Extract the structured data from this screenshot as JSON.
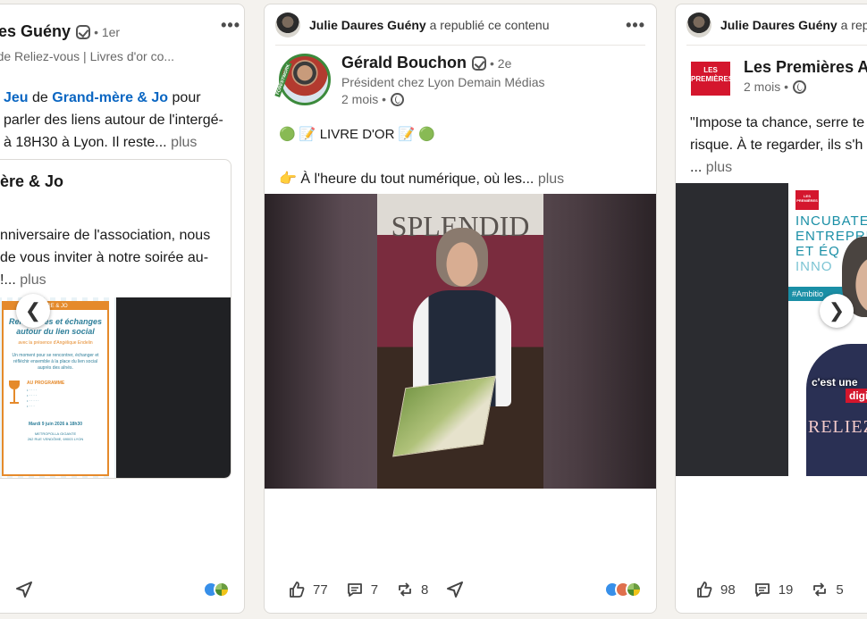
{
  "card1": {
    "actor_name": "ères Guény",
    "degree": "• 1er",
    "actor_sub": "te de Reliez-vous | Livres d'or co...",
    "commentary_link1": "Jeu",
    "commentary_text1": " de ",
    "commentary_link2": "Grand-mère & Jo",
    "commentary_text2": " pour",
    "commentary_line2": "parler des liens autour de l'intergé-",
    "commentary_line3": "à 18H30 à Lyon. Il reste...",
    "more": "plus",
    "inner_title": "ère & Jo",
    "inner_line1": "nniversaire de l'association, nous",
    "inner_line2": "de vous inviter à notre soirée au-",
    "inner_line3": "!...",
    "inner_more": "plus",
    "flyer": {
      "header": "ÈRE & JO",
      "title": "Rencontres et échanges autour du lien social",
      "subtitle": "avec la présence d'Angélique Endelin",
      "body": "Un moment pour se rencontrer, échanger et réfléchir ensemble à la place du lien social auprès des aînés.",
      "programme": "AU PROGRAMME",
      "date": "Mardi 9 juin 2026 à 18h30",
      "venue": "METROPOLLA GIGANTE",
      "address": "262 RUE VENDÔME, 69003 LYON"
    },
    "prev_arrow": "❮"
  },
  "card2": {
    "repost_actor": "Julie Daures Guény",
    "repost_text": " a republié ce contenu",
    "more_dots": "•••",
    "actor_name": "Gérald Bouchon",
    "degree": "• 2e",
    "actor_sub": "Président chez Lyon Demain Médias",
    "actor_meta": "2 mois •",
    "avatar_ring": "FORESTWORK",
    "line1": "🟢 📝 LIVRE D'OR 📝 🟢",
    "line2": "👉 À l'heure du tout numérique, où les...",
    "more": "plus",
    "video_sign": "SPLENDID",
    "likes": "77",
    "comments": "7",
    "reposts": "8"
  },
  "card3": {
    "repost_actor": "Julie Daures Guény",
    "repost_text": " a rep",
    "actor_name": "Les Premières A",
    "actor_meta": "2 mois •",
    "logo_text": "LES PREMIÈRES",
    "line1": "\"Impose ta chance, serre te",
    "line2": "risque. À te regarder, ils s'h",
    "line3": "...",
    "more": "plus",
    "slide": {
      "logo": "LES PREMIÈRES",
      "heading1": "INCUBATE",
      "heading2": "ENTREPRE",
      "heading3": "ET ÉQ",
      "heading4": "INNO",
      "hashtag": "#Ambitio",
      "caption1": "c'est une",
      "caption2": "digi",
      "shirt": "RELIEZ"
    },
    "next_arrow": "❯",
    "likes": "98",
    "comments": "19",
    "reposts": "5"
  },
  "colors": {
    "link": "#0a66c2",
    "card_border": "#dcdad6",
    "page_bg": "#f4f2ee",
    "flyer_teal": "#2f7f9a",
    "flyer_orange": "#e58a2b",
    "incubator_teal": "#1a8fa6",
    "brand_red": "#d4162d"
  }
}
